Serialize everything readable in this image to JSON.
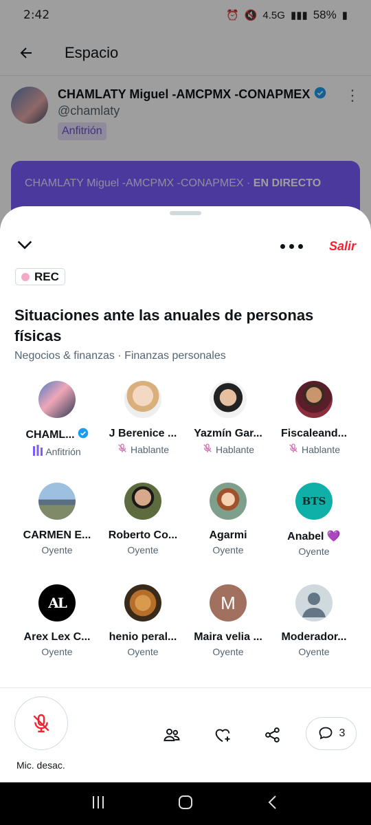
{
  "status_bar": {
    "time": "2:42",
    "network": "4.5G",
    "battery": "58%"
  },
  "topbar": {
    "title": "Espacio"
  },
  "host_card": {
    "name": "CHAMLATY Miguel -AMCPMX -CONAPMEX",
    "handle": "@chamlaty",
    "role": "Anfitrión"
  },
  "live_card": {
    "host": "CHAMLATY Miguel -AMCPMX -CONAPMEX · ",
    "status": "EN DIRECTO"
  },
  "sheet": {
    "leave_label": "Salir",
    "rec_label": "REC",
    "title": "Situaciones ante las anuales de personas físicas",
    "topics": "Negocios &  finanzas · Finanzas personales"
  },
  "participants": [
    {
      "name": "CHAML...",
      "role": "Anfitrión",
      "avatar": "photo-pink",
      "verified": true
    },
    {
      "name": "J Berenice ...",
      "role": "Hablante",
      "avatar": "photo-woman-blonde"
    },
    {
      "name": "Yazmín Gar...",
      "role": "Hablante",
      "avatar": "photo-woman-dark"
    },
    {
      "name": "Fiscaleand...",
      "role": "Hablante",
      "avatar": "photo-man-suit"
    },
    {
      "name": "CARMEN E...",
      "role": "Oyente",
      "avatar": "photo-landscape"
    },
    {
      "name": "Roberto Co...",
      "role": "Oyente",
      "avatar": "photo-man-glasses"
    },
    {
      "name": "Agarmi",
      "role": "Oyente",
      "avatar": "cartoon"
    },
    {
      "name": "Anabel 💜",
      "role": "Oyente",
      "avatar": "bts-logo",
      "avatar_text": "BTS"
    },
    {
      "name": "Arex Lex C...",
      "role": "Oyente",
      "avatar": "arex-logo",
      "avatar_text": "AL"
    },
    {
      "name": "henio peral...",
      "role": "Oyente",
      "avatar": "photo-bread"
    },
    {
      "name": "Maira velia ...",
      "role": "Oyente",
      "avatar": "initial",
      "avatar_text": "M"
    },
    {
      "name": "Moderador...",
      "role": "Oyente",
      "avatar": "default-user"
    }
  ],
  "footer": {
    "mic_label": "Mic. desac.",
    "comment_count": "3"
  },
  "colors": {
    "accent": "#1d9bf0",
    "danger": "#f4212e",
    "host_purple": "#7a5cff",
    "role_pink": "#d86fb4"
  }
}
